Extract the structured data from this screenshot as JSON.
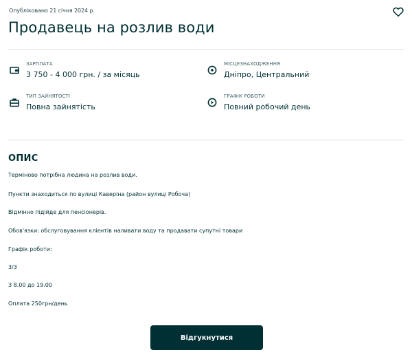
{
  "listing": {
    "published": "Опубліковано 21 січня 2024 р.",
    "title": "Продавець на розлив води"
  },
  "details": {
    "salary": {
      "label": "Зарплата",
      "value": "3 750 - 4 000 грн. / за місяць"
    },
    "location": {
      "label": "Місцезнаходження",
      "value": "Дніпро, Центральний"
    },
    "employment": {
      "label": "Тип зайнятості",
      "value": "Повна зайнятість"
    },
    "schedule": {
      "label": "Графік роботи",
      "value": "Повний робочий день"
    }
  },
  "description": {
    "title": "ОПИС",
    "lines": [
      "Терміново потрібна людина на розлив води.",
      "Пункти знаходиться по вулиці Каверіна (район вулиці Робоча)",
      "Відмінно підійде для пенсіонерів.",
      "Обов'язки: обслуговування клієнтів наливати воду та продавати супутні товари",
      "Графік роботи:",
      "3/3",
      "З 8.00 до 19.00",
      "Оплата 250грн/день"
    ]
  },
  "actions": {
    "respond_label": "Відгукнутися"
  },
  "icons": {
    "favorite": "heart-icon",
    "salary": "money-icon",
    "location": "location-pin-icon",
    "employment": "briefcase-icon",
    "schedule": "clock-icon"
  },
  "colors": {
    "primary": "#002f34",
    "button_text": "#ffffff",
    "divider": "#d8dfe0",
    "label": "#406367"
  }
}
